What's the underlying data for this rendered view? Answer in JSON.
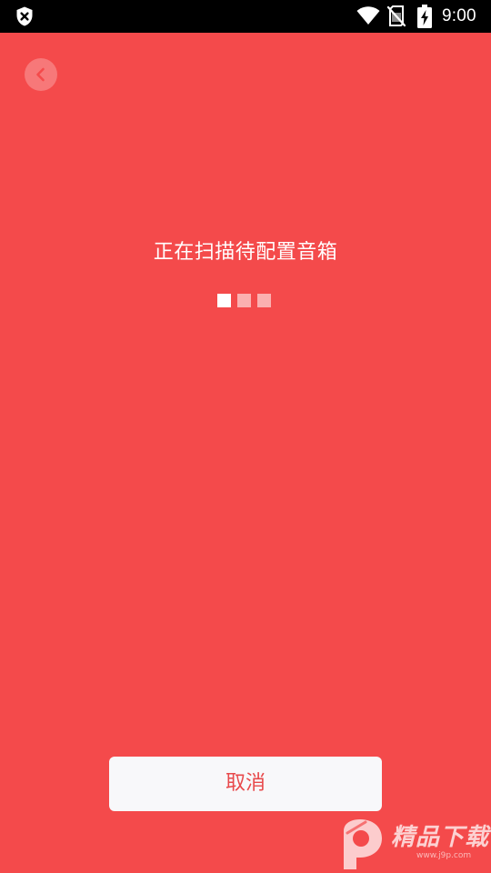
{
  "status_bar": {
    "time": "9:00",
    "icons": [
      "shield-x-icon",
      "wifi-icon",
      "no-sim-icon",
      "battery-charging-icon"
    ]
  },
  "back_button": {
    "icon": "chevron-left-icon"
  },
  "scan": {
    "title": "正在扫描待配置音箱"
  },
  "cancel_button": {
    "label": "取消"
  },
  "watermark": {
    "text": "精品下载",
    "url": "www.j9p.com"
  },
  "colors": {
    "background": "#f44a4b",
    "status_bar": "#000000",
    "cancel_text": "#e8494b",
    "cancel_background": "#f8f8fa",
    "dot_active": "#ffffff",
    "dot_inactive": "#fbb0b0"
  }
}
